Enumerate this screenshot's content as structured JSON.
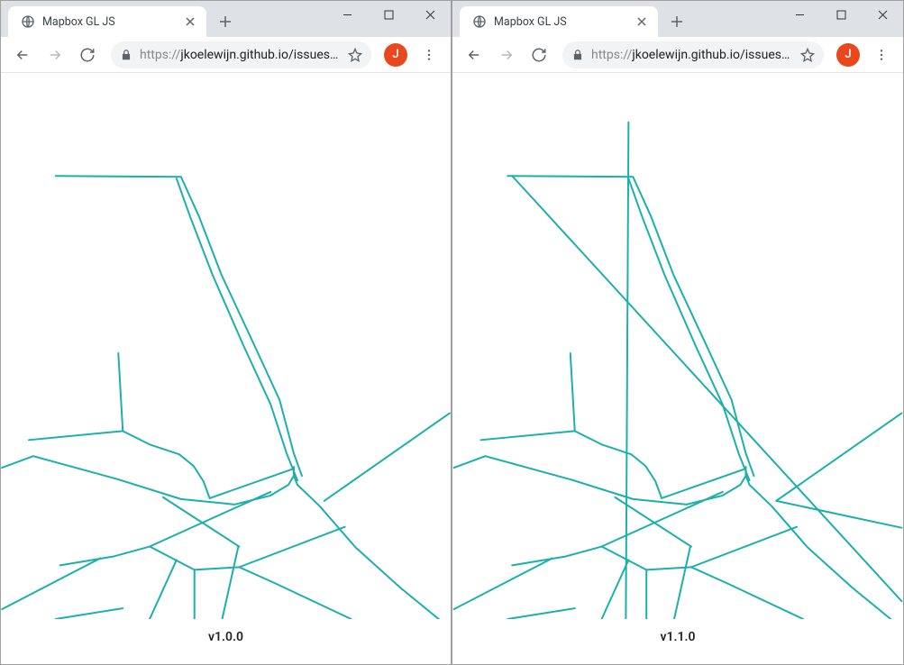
{
  "windows": [
    {
      "tab_title": "Mapbox GL JS",
      "url_scheme": "https://",
      "url_display": "jkoelewijn.github.io/issues/ma...",
      "avatar_initial": "J",
      "version": "v1.0.0"
    },
    {
      "tab_title": "Mapbox GL JS",
      "url_scheme": "https://",
      "url_display": "jkoelewijn.github.io/issues/ma...",
      "avatar_initial": "J",
      "version": "v1.1.0"
    }
  ],
  "colors": {
    "line_stroke": "#1bb0a9",
    "avatar_bg": "#e8481d"
  }
}
